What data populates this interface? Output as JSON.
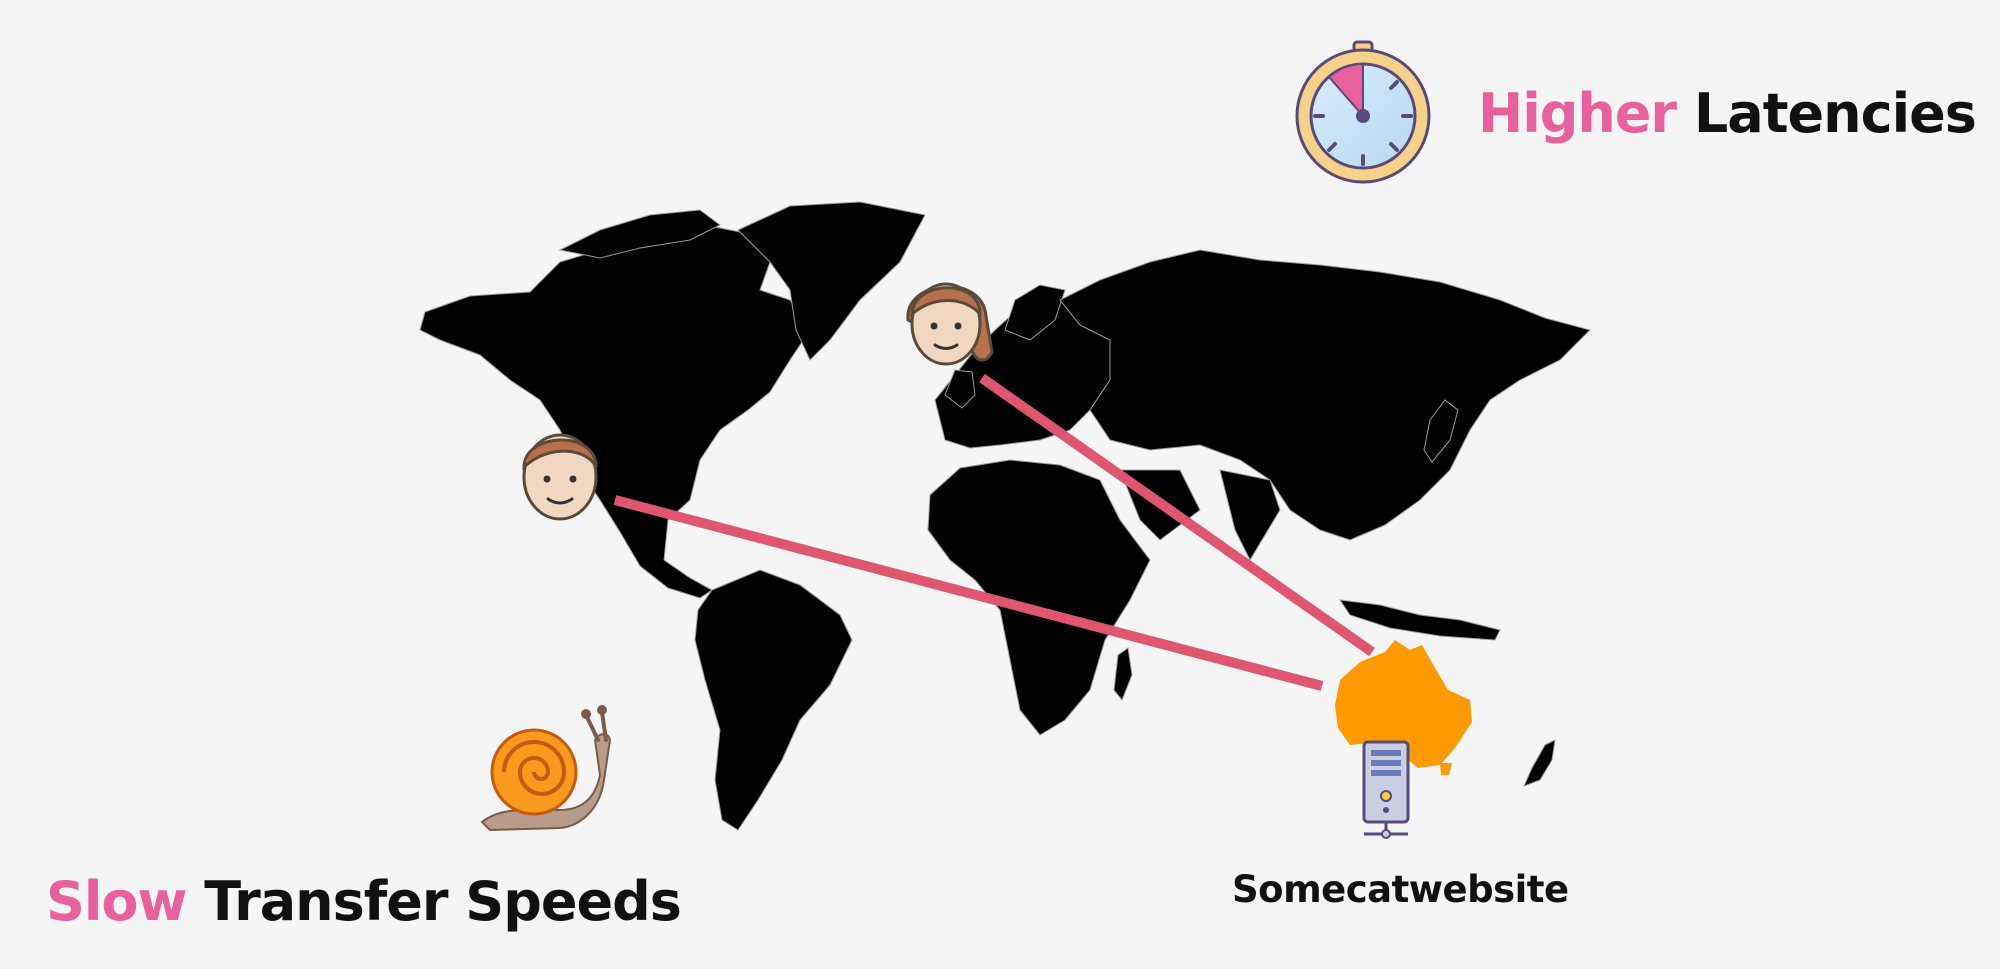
{
  "latency_heading": {
    "accent": "Higher",
    "rest": "Latencies"
  },
  "speed_heading": {
    "accent": "Slow",
    "rest": "Transfer Speeds"
  },
  "server": {
    "label": "Somecatwebsite"
  },
  "colors": {
    "background": "#f5f5f5",
    "land": "#000000",
    "highlight_region": "#ff9900",
    "connection_line": "#e05670",
    "accent_text": "#e8609d",
    "body_text": "#111111"
  },
  "icons": [
    "stopwatch-icon",
    "snail-icon",
    "server-icon",
    "user-avatar-icon"
  ]
}
